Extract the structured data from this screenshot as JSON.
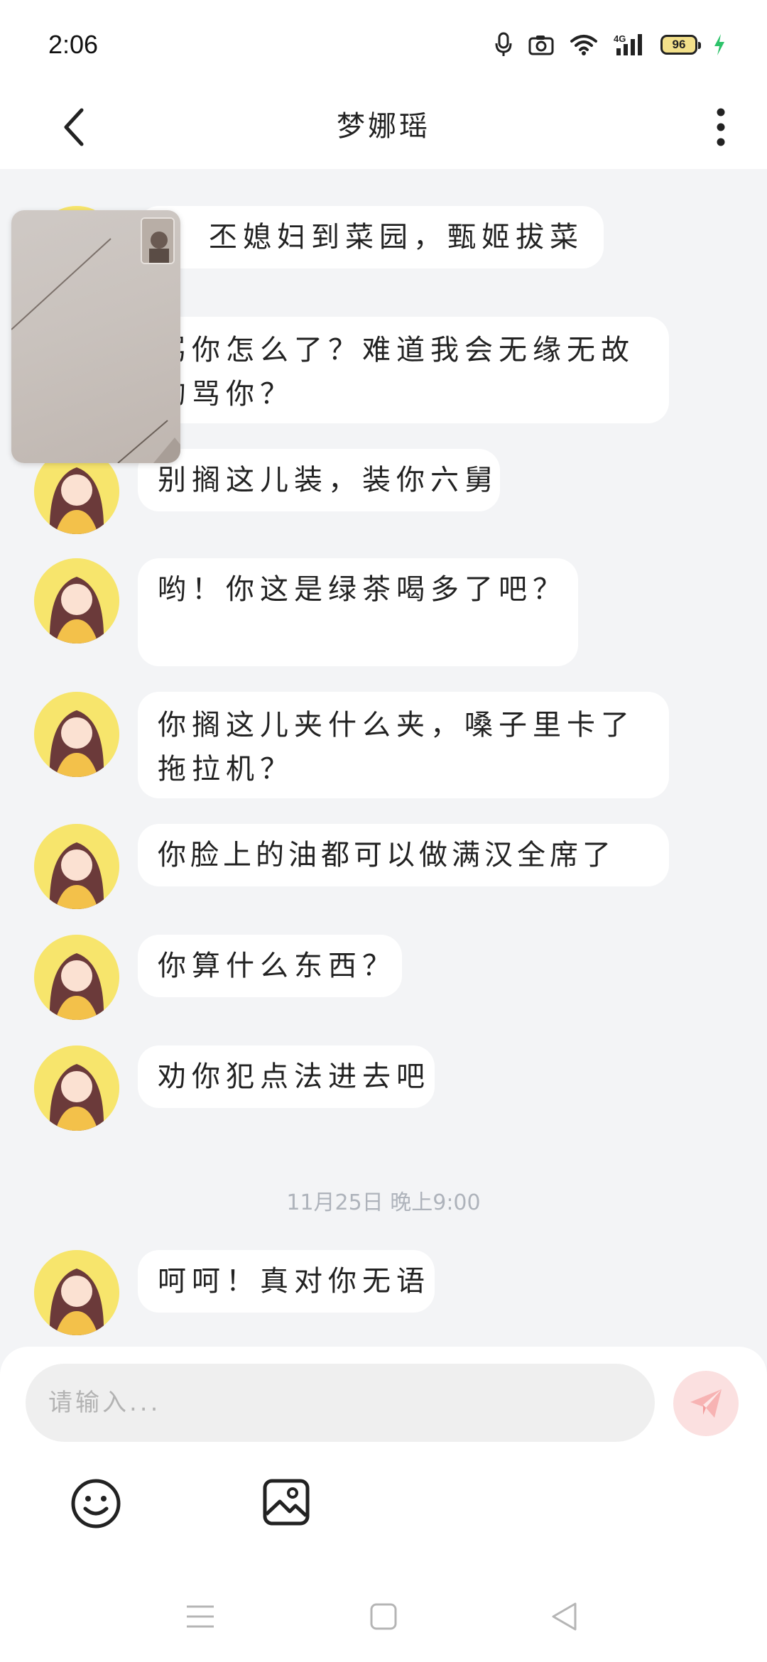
{
  "status_bar": {
    "time": "2:06",
    "battery": "96"
  },
  "header": {
    "title": "梦娜瑶"
  },
  "messages": [
    {
      "text": "丕媳妇到菜园，甄姬拔菜"
    },
    {
      "text": "骂你怎么了？难道我会无缘无故的骂你？"
    },
    {
      "text": "别搁这儿装，装你六舅"
    },
    {
      "text": "哟！你这是绿茶喝多了吧？"
    },
    {
      "text": "你搁这儿夹什么夹，嗓子里卡了拖拉机？"
    },
    {
      "text": "你脸上的油都可以做满汉全席了"
    },
    {
      "text": "你算什么东西？"
    },
    {
      "text": "劝你犯点法进去吧"
    },
    {
      "text": "呵呵！真对你无语"
    }
  ],
  "timestamp": "11月25日 晚上9:00",
  "composer": {
    "placeholder": "请输入..."
  },
  "colors": {
    "bubble": "#ffffff",
    "background": "#f3f4f6",
    "send": "#f08a8a"
  },
  "icons": {
    "back": "chevron-left-icon",
    "more": "more-vertical-icon",
    "send": "paper-plane-icon",
    "emoji": "smiley-icon",
    "image": "image-icon",
    "nav_menu": "menu-icon",
    "nav_home": "square-icon",
    "nav_back": "triangle-back-icon"
  }
}
